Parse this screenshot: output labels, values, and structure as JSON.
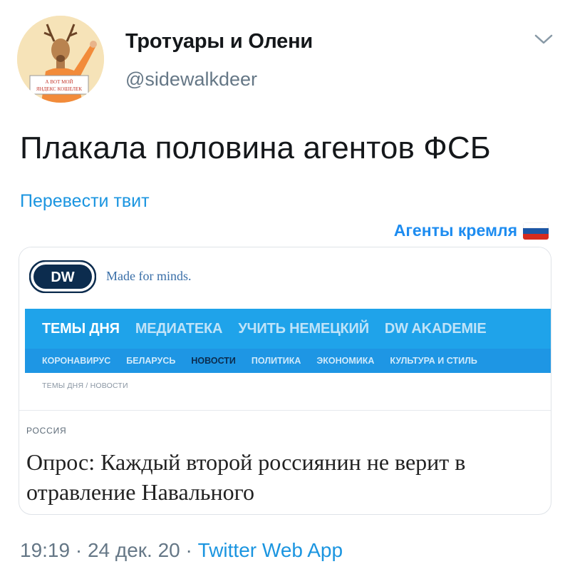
{
  "author": {
    "display_name": "Тротуары и Олени",
    "handle": "@sidewalkdeer",
    "avatar_sign_text": "А ВОТ МОЙ ЯНДЕКС КОШЕЛЕК"
  },
  "tweet": {
    "text": "Плакала половина агентов ФСБ",
    "translate_label": "Перевести твит",
    "overlay_text": "Агенты кремля"
  },
  "card": {
    "logo_text": "DW",
    "slogan": "Made for minds.",
    "nav_main": [
      "ТЕМЫ ДНЯ",
      "МЕДИАТЕКА",
      "УЧИТЬ НЕМЕЦКИЙ",
      "DW AKADEMIE"
    ],
    "nav_sub": [
      "КОРОНАВИРУС",
      "БЕЛАРУСЬ",
      "НОВОСТИ",
      "ПОЛИТИКА",
      "ЭКОНОМИКА",
      "КУЛЬТУРА И СТИЛЬ"
    ],
    "breadcrumb": "ТЕМЫ ДНЯ / НОВОСТИ",
    "section": "РОССИЯ",
    "headline": "Опрос: Каждый второй россиянин не верит в отравление Навального"
  },
  "meta": {
    "time": "19:19",
    "date": "24 дек. 20",
    "source": "Twitter Web App"
  },
  "colors": {
    "link_blue": "#1b95e0",
    "dw_nav_blue": "#1fa3ea",
    "dw_dark_blue": "#0c2c4e",
    "text_gray": "#657786"
  }
}
